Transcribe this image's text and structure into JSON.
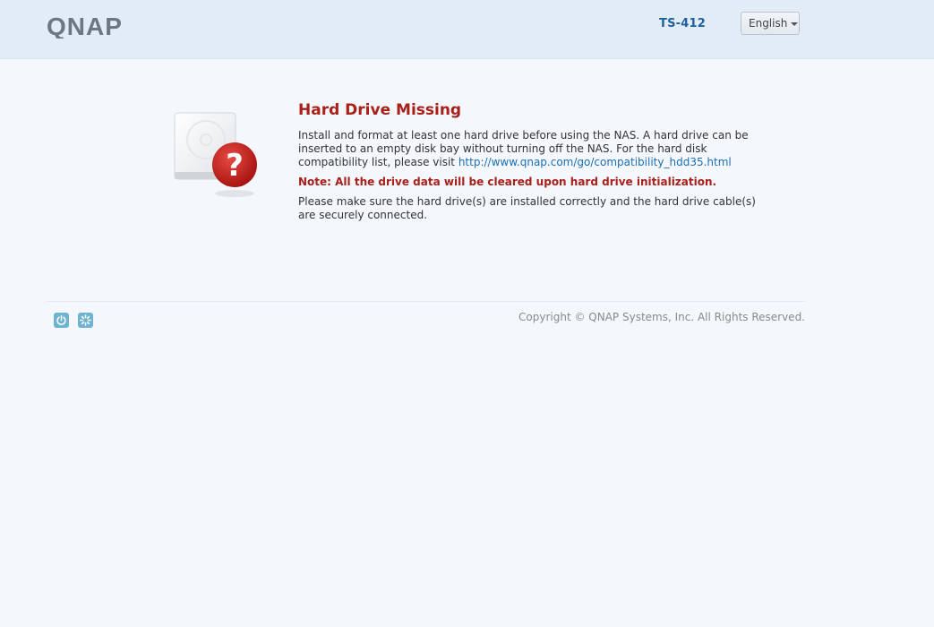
{
  "header": {
    "logo_text": "QNAP",
    "model": "TS-412",
    "language": "English"
  },
  "message": {
    "title": "Hard Drive Missing",
    "body_text": "Install and format at least one hard drive before using the NAS. A hard drive can be inserted to an empty disk bay without turning off the NAS. For the hard disk compatibility list, please visit ",
    "link_text": "http://www.qnap.com/go/compatibility_hdd35.html",
    "note": "Note: All the drive data will be cleared upon hard drive initialization.",
    "check_text": "Please make sure the hard drive(s) are installed correctly and the hard drive cable(s) are securely connected."
  },
  "footer": {
    "power_icon": "power-icon",
    "restart_icon": "restart-icon",
    "copyright": "Copyright © QNAP Systems, Inc. All Rights Reserved."
  },
  "colors": {
    "header_bg": "#e2ecf6",
    "title_red": "#a8201a",
    "link_blue": "#1b6fb5",
    "model_blue": "#1f5f9e",
    "icon_blue": "#6eb3cf"
  }
}
